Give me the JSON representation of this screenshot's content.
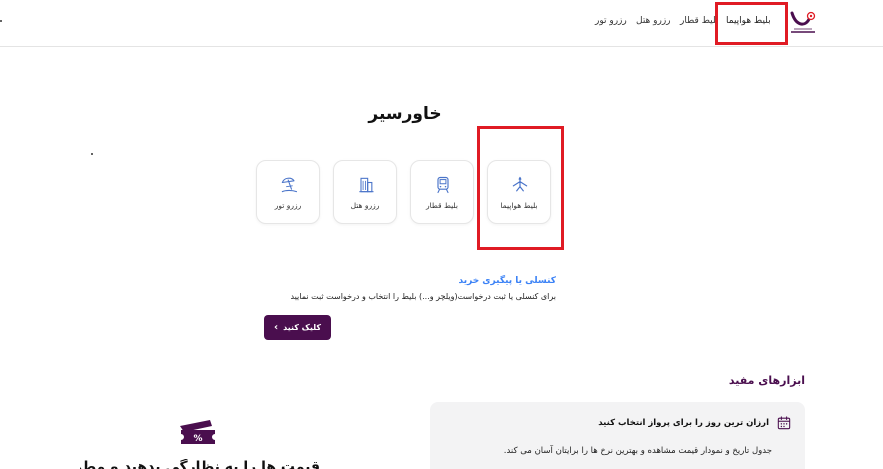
{
  "nav": {
    "items": [
      {
        "label": "بلیط هواپیما",
        "active": true
      },
      {
        "label": "بلیط قطار"
      },
      {
        "label": "رزرو هتل"
      },
      {
        "label": "رزرو تور"
      }
    ]
  },
  "brand": {
    "title": "خاورسیر"
  },
  "services": [
    {
      "label": "بلیط هواپیما",
      "icon": "airplane-icon"
    },
    {
      "label": "بلیط قطار",
      "icon": "train-icon"
    },
    {
      "label": "رزرو هتل",
      "icon": "hotel-icon"
    },
    {
      "label": "رزرو تور",
      "icon": "beach-umbrella-icon"
    }
  ],
  "cancel": {
    "title": "کنسلی یا پیگیری خرید",
    "description": "برای کنسلی یا ثبت درخواست(ویلچر و...) بلیط را انتخاب و درخواست ثبت نمایید",
    "button_label": "کلیک کنید"
  },
  "tools": {
    "title": "ابزارهای مفید",
    "card": {
      "title": "ارزان ترین روز را برای پرواز انتخاب کنید",
      "description": "جدول تاریخ و نمودار قیمت مشاهده و بهترین نرخ ها را برایتان آسان می کند."
    },
    "partial_heading": "قیمت ها را به نظارگی بدهید و مطمئن شوید"
  },
  "colors": {
    "brand_purple": "#4a0e4e",
    "link_blue": "#3b82f6",
    "highlight_red": "#e01b24",
    "icon_blue": "#4a74c9"
  }
}
